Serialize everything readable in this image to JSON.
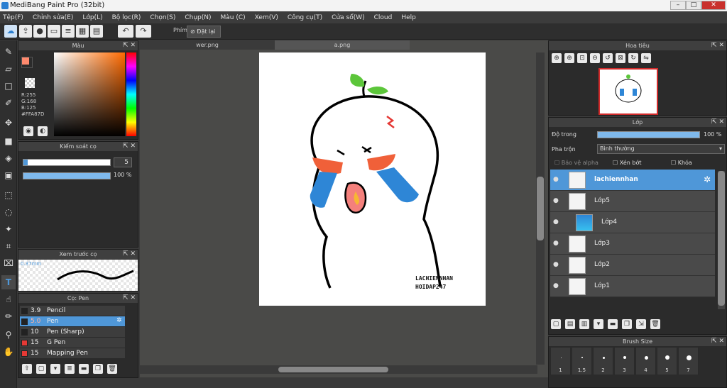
{
  "window": {
    "title": "MediBang Paint Pro (32bit)",
    "min": "–",
    "max": "□",
    "close": "✕"
  },
  "menu": [
    "Tệp(F)",
    "Chỉnh sửa(E)",
    "Lớp(L)",
    "Bộ lọc(R)",
    "Chọn(S)",
    "Chụp(N)",
    "Màu (C)",
    "Xem(V)",
    "Công cụ(T)",
    "Cửa sổ(W)",
    "Cloud",
    "Help"
  ],
  "toolbar": {
    "key_label": "Phím",
    "key_button": "Đặt lại"
  },
  "color_panel": {
    "title": "Màu",
    "r": "R:255",
    "g": "G:168",
    "b": "B:125",
    "hex": "#FFA87D",
    "fg": "#ff8a6e",
    "hue": "#ff6a00"
  },
  "stroke_panel": {
    "title": "Kiểm soát cọ",
    "size": "5",
    "opacity": "100 %"
  },
  "preview_panel": {
    "title": "Xem trước cọ",
    "size_label": "0.37mm"
  },
  "brush_panel": {
    "title": "Cọ: Pen",
    "items": [
      {
        "size": "3.9",
        "name": "Pencil",
        "color": "#222"
      },
      {
        "size": "5.0",
        "name": "Pen",
        "color": "#222",
        "selected": true
      },
      {
        "size": "10",
        "name": "Pen (Sharp)",
        "color": "#222"
      },
      {
        "size": "15",
        "name": "G Pen",
        "color": "#e53935"
      },
      {
        "size": "15",
        "name": "Mapping Pen",
        "color": "#e53935"
      }
    ]
  },
  "tabs": [
    "wer.png",
    "a.png"
  ],
  "canvas": {
    "sig1": "LACHIENNHAN",
    "sig2": "HOIDAP247"
  },
  "navigator": {
    "title": "Hoa tiêu"
  },
  "layer_panel": {
    "title": "Lớp",
    "opacity_label": "Độ trong",
    "opacity_value": "100 %",
    "blend_label": "Pha trộn",
    "blend_value": "Bình thường",
    "alpha": "Bảo vệ alpha",
    "clip": "Xén bớt",
    "lock": "Khóa",
    "layers": [
      {
        "name": "lachiennhan",
        "selected": true
      },
      {
        "name": "Lớp5"
      },
      {
        "name": "Lớp4",
        "child": true
      },
      {
        "name": "Lớp3"
      },
      {
        "name": "Lớp2"
      },
      {
        "name": "Lớp1"
      }
    ]
  },
  "brushsize_panel": {
    "title": "Brush Size",
    "sizes": [
      "1",
      "1.5",
      "2",
      "3",
      "4",
      "5",
      "7"
    ]
  }
}
